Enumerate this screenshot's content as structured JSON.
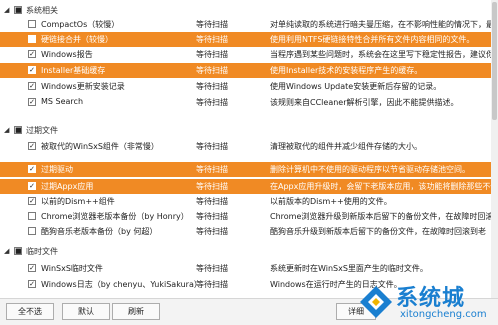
{
  "groups": [
    {
      "name": "系统相关",
      "items": [
        {
          "name": "CompactOs（较慢）",
          "status": "等待扫描",
          "desc": "对单纯读取的系统进行暗夫曼压缩，在不影响性能的情况下，最省",
          "checked": false,
          "highlight": false
        },
        {
          "name": "硬链接合并（较慢）",
          "status": "等待扫描",
          "desc": "使用利用NTFS硬链接特性合并所有文件内容相同的文件。",
          "checked": false,
          "highlight": true
        },
        {
          "name": "Windows报告",
          "status": "等待扫描",
          "desc": "当程序遇到某些问题时，系统会在这里写下稳定性报告，建议你定期",
          "checked": true,
          "highlight": false
        },
        {
          "name": "Installer基础缓存",
          "status": "等待扫描",
          "desc": "使用Installer技术的安装程序产生的缓存。",
          "checked": true,
          "highlight": true
        },
        {
          "name": "Windows更新安装记录",
          "status": "等待扫描",
          "desc": "使用Windows Update安装更新后存留的记录。",
          "checked": true,
          "highlight": false
        },
        {
          "name": "MS Search",
          "status": "等待扫描",
          "desc": "该规则来自CCleaner解析引擎，因此不能提供描述。",
          "checked": true,
          "highlight": false
        }
      ]
    },
    {
      "name": "过期文件",
      "items": [
        {
          "name": "被取代的WinSxS组件（非常慢）",
          "status": "等待扫描",
          "desc": "清理被取代的组件并减少组件存储的大小。",
          "checked": true,
          "highlight": false
        },
        {
          "name": "过期驱动",
          "status": "等待扫描",
          "desc": "删除计算机中不使用的驱动程序以节省驱动存储池空间。",
          "checked": true,
          "highlight": true
        },
        {
          "name": "过期Appx应用",
          "status": "等待扫描",
          "desc": "在Appx应用升级时，会留下老版本应用，该功能将删除那些不使用",
          "checked": true,
          "highlight": true
        },
        {
          "name": "以前的Dism++组件",
          "status": "等待扫描",
          "desc": "以前版本的Dism++使用的文件。",
          "checked": true,
          "highlight": false
        },
        {
          "name": "Chrome浏览器老版本备份（by Honry）",
          "status": "等待扫描",
          "desc": "Chrome浏览器升级到新版本后留下的备份文件，在故障时回滚到老",
          "checked": false,
          "highlight": false
        },
        {
          "name": "酷狗音乐老版本备份（by 何超）",
          "status": "等待扫描",
          "desc": "酷狗音乐升级到新版本后留下的备份文件，在故障时回滚到老",
          "checked": false,
          "highlight": false
        }
      ]
    },
    {
      "name": "临时文件",
      "items": [
        {
          "name": "WinSxS临时文件",
          "status": "等待扫描",
          "desc": "系统更新时在WinSxS里面产生的临时文件。",
          "checked": true,
          "highlight": false
        },
        {
          "name": "Windows日志（by chenyu、YukiSakura）",
          "status": "等待扫描",
          "desc": "Windows在运行时产生的日志文件。",
          "checked": true,
          "highlight": false
        }
      ]
    }
  ],
  "buttons": {
    "select_all": "全不选",
    "default": "默认",
    "refresh": "刷新",
    "analyze": "详细"
  },
  "watermark": {
    "brand": "系统城",
    "url": "xitongcheng.com"
  },
  "colors": {
    "highlight": "#f08a24",
    "watermark": "#1a7fd0"
  }
}
